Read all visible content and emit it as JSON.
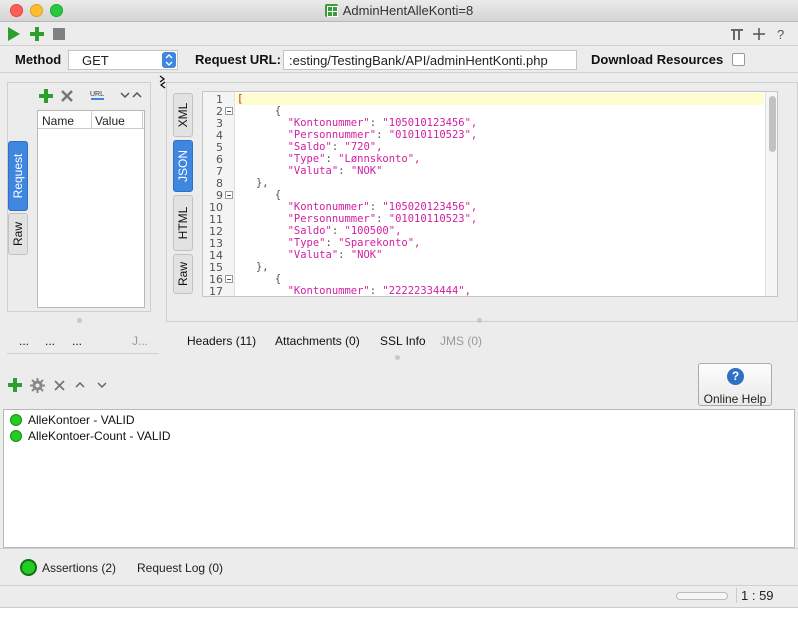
{
  "window": {
    "title": "AdminHentAlleKonti=8"
  },
  "request_bar": {
    "method_label": "Method",
    "method_value": "GET",
    "url_label": "Request URL:",
    "url_value": ":esting/TestingBank/API/adminHentKonti.php",
    "download_label": "Download Resources"
  },
  "params": {
    "col_name": "Name",
    "col_value": "Value"
  },
  "left_tabs": [
    "Request",
    "Raw"
  ],
  "response_tabs": [
    "XML",
    "JSON",
    "HTML",
    "Raw"
  ],
  "code_lines": [
    {
      "n": "1",
      "text": "["
    },
    {
      "n": "2",
      "text": "      {"
    },
    {
      "n": "3",
      "key": "\"Kontonummer\"",
      "val": "\"105010123456\","
    },
    {
      "n": "4",
      "key": "\"Personnummer\"",
      "val": "\"01010110523\","
    },
    {
      "n": "5",
      "key": "\"Saldo\"",
      "val": "\"720\","
    },
    {
      "n": "6",
      "key": "\"Type\"",
      "val": "\"Lønnskonto\","
    },
    {
      "n": "7",
      "key": "\"Valuta\"",
      "val": "\"NOK\""
    },
    {
      "n": "8",
      "text": "   },"
    },
    {
      "n": "9",
      "text": "      {"
    },
    {
      "n": "10",
      "key": "\"Kontonummer\"",
      "val": "\"105020123456\","
    },
    {
      "n": "11",
      "key": "\"Personnummer\"",
      "val": "\"01010110523\","
    },
    {
      "n": "12",
      "key": "\"Saldo\"",
      "val": "\"100500\","
    },
    {
      "n": "13",
      "key": "\"Type\"",
      "val": "\"Sparekonto\","
    },
    {
      "n": "14",
      "key": "\"Valuta\"",
      "val": "\"NOK\""
    },
    {
      "n": "15",
      "text": "   },"
    },
    {
      "n": "16",
      "text": "      {"
    },
    {
      "n": "17",
      "key": "\"Kontonummer\"",
      "val": "\"22222334444\","
    }
  ],
  "left_bottom_tabs": [
    "...",
    "...",
    "...",
    "J..."
  ],
  "bottom_tabs": [
    {
      "label": "Headers (11)"
    },
    {
      "label": "Attachments (0)"
    },
    {
      "label": "SSL Info"
    },
    {
      "label": "JMS (0)"
    }
  ],
  "online_help": "Online Help",
  "assertions": [
    {
      "label": "AlleKontoer - VALID"
    },
    {
      "label": "AlleKontoer-Count - VALID"
    }
  ],
  "footer": {
    "assertions_tab": "Assertions (2)",
    "request_log_tab": "Request Log (0)"
  },
  "status": {
    "cursor": "1 : 59"
  },
  "colors": {
    "accent": "#3f86e0",
    "key_color": "#d11fa0",
    "valid": "#22cc22"
  }
}
